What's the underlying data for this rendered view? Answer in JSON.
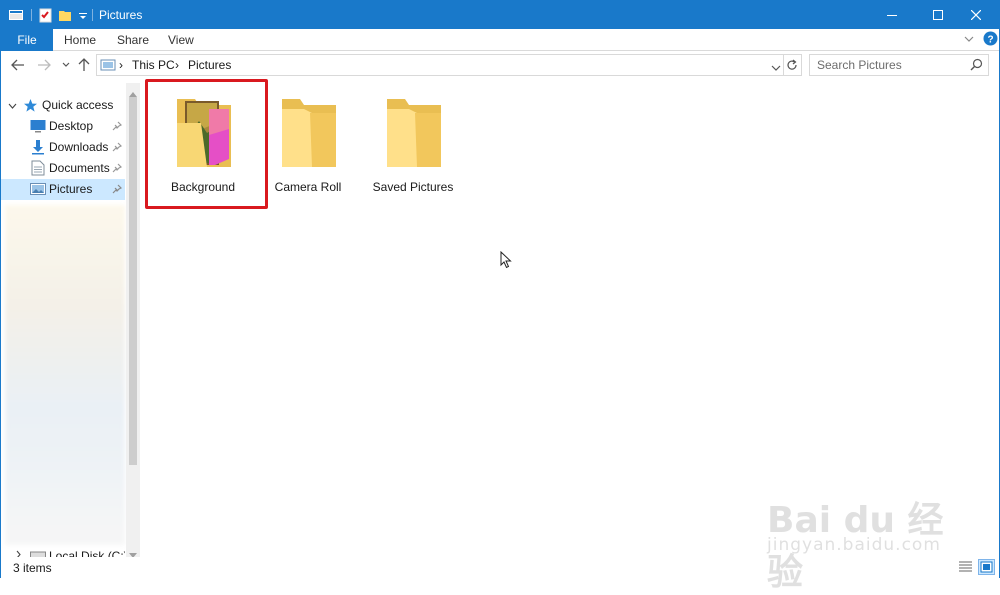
{
  "window": {
    "title": "Pictures",
    "accent_color": "#1979ca",
    "highlight_color": "#d9191f"
  },
  "title_bar": {
    "icons": [
      "explorer-window-icon",
      "properties-icon",
      "new-folder-icon",
      "customize-dropdown-icon"
    ],
    "controls": [
      "minimize-icon",
      "maximize-icon",
      "close-icon"
    ]
  },
  "ribbon": {
    "tabs": [
      {
        "label": "File",
        "active": true
      },
      {
        "label": "Home"
      },
      {
        "label": "Share"
      },
      {
        "label": "View"
      }
    ]
  },
  "address_bar": {
    "breadcrumbs": [
      "This PC",
      "Pictures"
    ]
  },
  "search": {
    "placeholder": "Search Pictures"
  },
  "nav_pane": {
    "header": "Quick access",
    "items": [
      {
        "label": "Desktop",
        "icon": "desktop-icon",
        "pinned": true
      },
      {
        "label": "Downloads",
        "icon": "downloads-icon",
        "pinned": true
      },
      {
        "label": "Documents",
        "icon": "documents-icon",
        "pinned": true
      },
      {
        "label": "Pictures",
        "icon": "pictures-icon",
        "pinned": true,
        "selected": true
      }
    ],
    "bottom_item": "Local Disk (C:)"
  },
  "content": {
    "folders": [
      {
        "name": "Background",
        "icon": "folder-with-image-icon",
        "highlighted": true
      },
      {
        "name": "Camera Roll",
        "icon": "folder-icon"
      },
      {
        "name": "Saved Pictures",
        "icon": "folder-icon"
      }
    ]
  },
  "status_bar": {
    "item_count": "3 items"
  },
  "watermark": {
    "logo": "Bai du 经验",
    "url": "jingyan.baidu.com"
  }
}
